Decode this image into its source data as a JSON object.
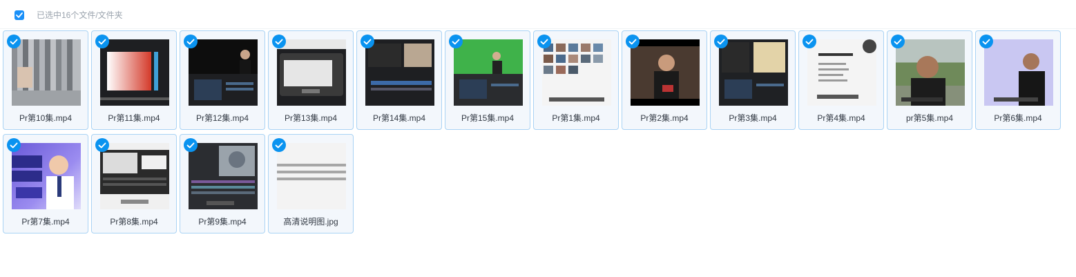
{
  "toolbar": {
    "select_all_checked": true,
    "selection_text": "已选中16个文件/文件夹"
  },
  "colors": {
    "accent": "#0a93f0",
    "tile_border": "#a9d3f4",
    "tile_bg": "#f3f7fc",
    "label_text": "#333a44",
    "muted_text": "#9aa3ad"
  },
  "files": [
    {
      "name": "Pr第10集.mp4",
      "type": "video",
      "selected": true
    },
    {
      "name": "Pr第11集.mp4",
      "type": "video",
      "selected": true
    },
    {
      "name": "Pr第12集.mp4",
      "type": "video",
      "selected": true
    },
    {
      "name": "Pr第13集.mp4",
      "type": "video",
      "selected": true
    },
    {
      "name": "Pr第14集.mp4",
      "type": "video",
      "selected": true
    },
    {
      "name": "Pr第15集.mp4",
      "type": "video",
      "selected": true
    },
    {
      "name": "Pr第1集.mp4",
      "type": "video",
      "selected": true
    },
    {
      "name": "Pr第2集.mp4",
      "type": "video",
      "selected": true
    },
    {
      "name": "Pr第3集.mp4",
      "type": "video",
      "selected": true
    },
    {
      "name": "Pr第4集.mp4",
      "type": "video",
      "selected": true
    },
    {
      "name": "pr第5集.mp4",
      "type": "video",
      "selected": true
    },
    {
      "name": "Pr第6集.mp4",
      "type": "video",
      "selected": true
    },
    {
      "name": "Pr第7集.mp4",
      "type": "video",
      "selected": true
    },
    {
      "name": "Pr第8集.mp4",
      "type": "video",
      "selected": true
    },
    {
      "name": "Pr第9集.mp4",
      "type": "video",
      "selected": true
    },
    {
      "name": "高清说明图.jpg",
      "type": "image",
      "selected": true
    }
  ],
  "icons": {
    "selected": "check-icon"
  }
}
